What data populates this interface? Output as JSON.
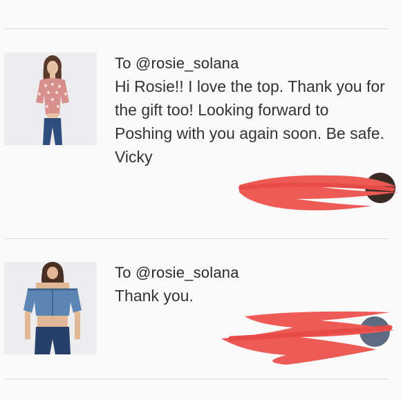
{
  "feed": {
    "items": [
      {
        "recipient": "To @rosie_solana",
        "message": "Hi Rosie!! I love the top. Thank you for the gift too! Looking forward to Poshing with you again soon. Be safe. Vicky",
        "image_icon": "pink-polka-dot-top-photo"
      },
      {
        "recipient": "To @rosie_solana",
        "message": "Thank you.",
        "image_icon": "denim-crop-top-photo"
      }
    ]
  },
  "colors": {
    "background": "#fafafa",
    "divider": "#d9d9d9",
    "redaction": "#ee5a55",
    "text": "#333333"
  }
}
